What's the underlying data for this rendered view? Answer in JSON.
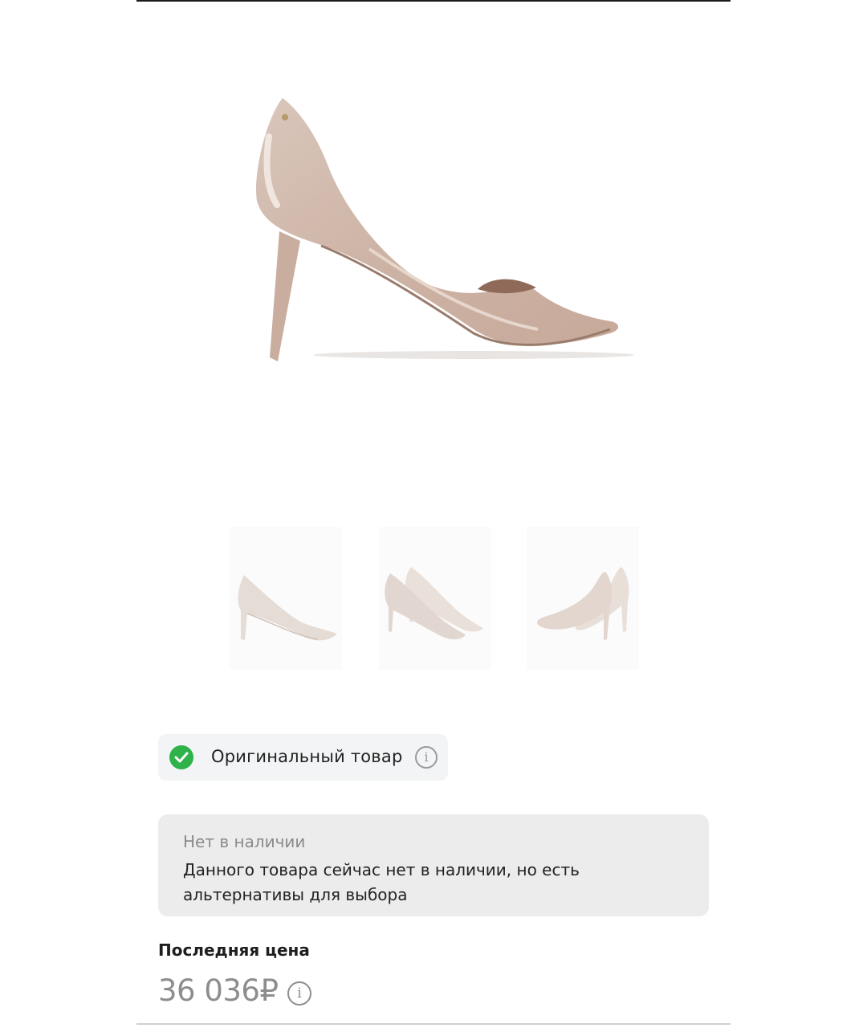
{
  "product": {
    "main_image_icon": "pump-shoe-side-view",
    "thumbnails": [
      {
        "icon": "pump-shoe-side-view"
      },
      {
        "icon": "pump-shoe-pair-front"
      },
      {
        "icon": "pump-shoe-pair-back"
      }
    ]
  },
  "badge": {
    "label": "Оригинальный товар",
    "check_color": "#2fb24a",
    "info_icon": "info-icon"
  },
  "stock": {
    "title": "Нет в наличии",
    "text": "Данного товара сейчас нет в наличии, но есть альтернативы для выбора"
  },
  "price": {
    "label": "Последняя цена",
    "value": "36 036₽",
    "info_icon": "info-icon"
  }
}
